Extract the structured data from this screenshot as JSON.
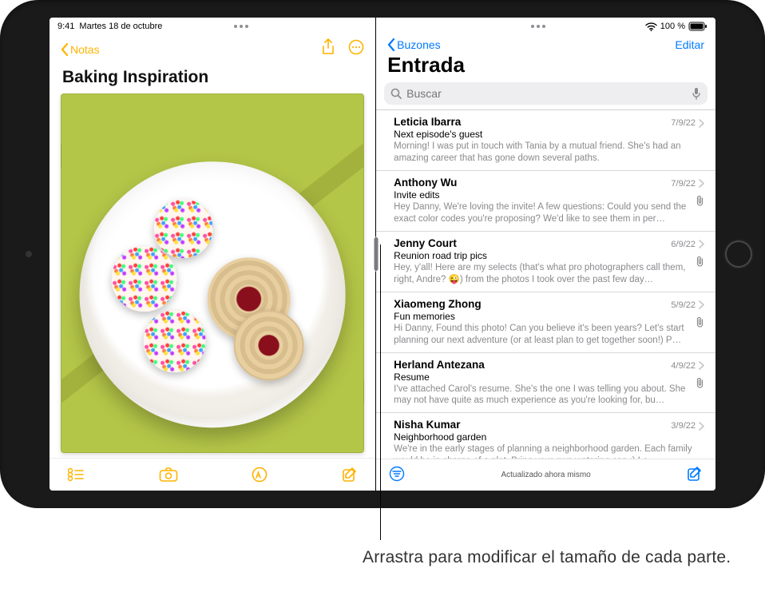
{
  "status": {
    "time": "9:41",
    "date": "Martes 18 de octubre",
    "battery": "100 %",
    "wifi_icon": "wifi",
    "battery_icon": "battery-full"
  },
  "notes": {
    "back_label": "Notas",
    "title": "Baking Inspiration",
    "toolbar": {
      "checklist": "checklist",
      "camera": "camera",
      "markup": "markup",
      "compose": "compose"
    },
    "share": "share",
    "more": "more"
  },
  "mail": {
    "back_label": "Buzones",
    "edit_label": "Editar",
    "title": "Entrada",
    "search_placeholder": "Buscar",
    "updated": "Actualizado ahora mismo",
    "messages": [
      {
        "sender": "Leticia Ibarra",
        "date": "7/9/22",
        "subject": "Next episode's guest",
        "preview": "Morning! I was put in touch with Tania by a mutual friend. She's had an amazing career that has gone down several paths.",
        "attachment": false
      },
      {
        "sender": "Anthony Wu",
        "date": "7/9/22",
        "subject": "Invite edits",
        "preview": "Hey Danny, We're loving the invite! A few questions: Could you send the exact color codes you're proposing? We'd like to see them in per…",
        "attachment": true
      },
      {
        "sender": "Jenny Court",
        "date": "6/9/22",
        "subject": "Reunion road trip pics",
        "preview": "Hey, y'all! Here are my selects (that's what pro photographers call them, right, Andre? 😜) from the photos I took over the past few day…",
        "attachment": true
      },
      {
        "sender": "Xiaomeng Zhong",
        "date": "5/9/22",
        "subject": "Fun memories",
        "preview": "Hi Danny, Found this photo! Can you believe it's been years? Let's start planning our next adventure (or at least plan to get together soon!) P…",
        "attachment": true
      },
      {
        "sender": "Herland Antezana",
        "date": "4/9/22",
        "subject": "Resume",
        "preview": "I've attached Carol's resume. She's the one I was telling you about. She may not have quite as much experience as you're looking for, bu…",
        "attachment": true
      },
      {
        "sender": "Nisha Kumar",
        "date": "3/9/22",
        "subject": "Neighborhood garden",
        "preview": "We're in the early stages of planning a neighborhood garden. Each family would be in charge of a plot. Bring your own watering can :) Le…",
        "attachment": false
      }
    ]
  },
  "annotation": {
    "text": "Arrastra para modificar el tamaño de cada parte."
  }
}
